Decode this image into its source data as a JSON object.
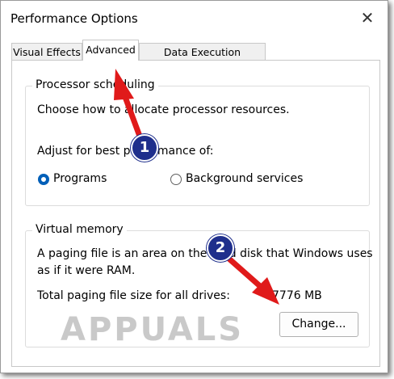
{
  "window": {
    "title": "Performance Options",
    "close_glyph": "✕"
  },
  "tabs": [
    {
      "label": "Visual Effects"
    },
    {
      "label": "Advanced"
    },
    {
      "label": "Data Execution Prevention"
    }
  ],
  "processor": {
    "title": "Processor scheduling",
    "description": "Choose how to allocate processor resources.",
    "adjust_label": "Adjust for best performance of:",
    "options": [
      {
        "label": "Programs",
        "selected": true
      },
      {
        "label": "Background services",
        "selected": false
      }
    ]
  },
  "virtual_memory": {
    "title": "Virtual memory",
    "desc_line1": "A paging file is an area on the hard disk that Windows uses",
    "desc_line2": "as if it were RAM.",
    "total_label": "Total paging file size for all drives:",
    "total_value": "7776 MB",
    "change_button": "Change..."
  },
  "annotations": {
    "badge1": "1",
    "badge2": "2"
  },
  "watermark": "APPUALS",
  "colors": {
    "accent": "#005fb8",
    "arrow": "#e01a1a",
    "badge": "#1f2f8c"
  }
}
